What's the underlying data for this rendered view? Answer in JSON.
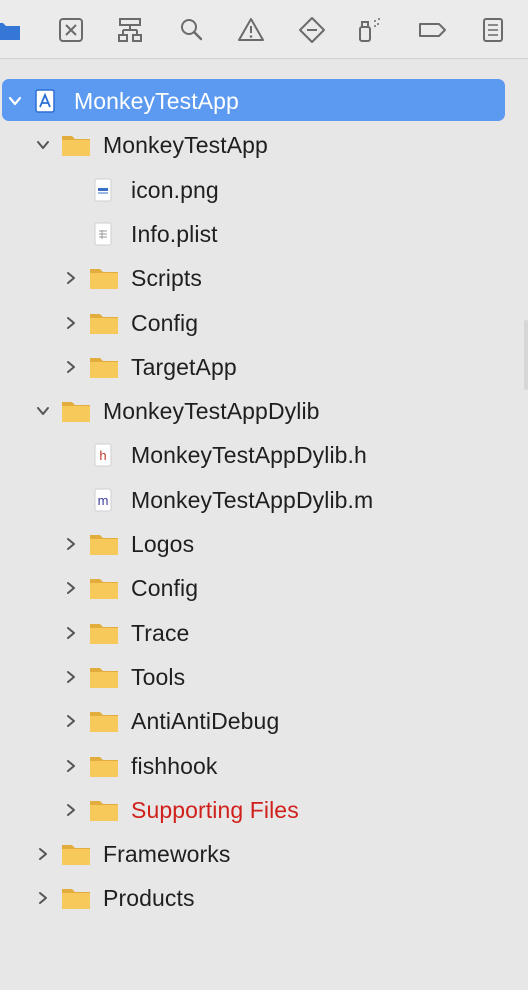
{
  "toolbar": {
    "icons": [
      "folder-icon",
      "source-control-icon",
      "hierarchy-icon",
      "search-icon",
      "warning-icon",
      "test-diamond-icon",
      "debug-spray-icon",
      "breakpoint-icon",
      "report-icon"
    ]
  },
  "tree": [
    {
      "label": "MonkeyTestApp",
      "kind": "project",
      "depth": 0,
      "disclosure": "open",
      "selected": true
    },
    {
      "label": "MonkeyTestApp",
      "kind": "folder",
      "depth": 1,
      "disclosure": "open"
    },
    {
      "label": "icon.png",
      "kind": "png",
      "depth": 2,
      "disclosure": "none"
    },
    {
      "label": "Info.plist",
      "kind": "plist",
      "depth": 2,
      "disclosure": "none"
    },
    {
      "label": "Scripts",
      "kind": "folder",
      "depth": 2,
      "disclosure": "closed"
    },
    {
      "label": "Config",
      "kind": "folder",
      "depth": 2,
      "disclosure": "closed"
    },
    {
      "label": "TargetApp",
      "kind": "folder",
      "depth": 2,
      "disclosure": "closed"
    },
    {
      "label": "MonkeyTestAppDylib",
      "kind": "folder",
      "depth": 1,
      "disclosure": "open"
    },
    {
      "label": "MonkeyTestAppDylib.h",
      "kind": "h",
      "depth": 2,
      "disclosure": "none"
    },
    {
      "label": "MonkeyTestAppDylib.m",
      "kind": "m",
      "depth": 2,
      "disclosure": "none"
    },
    {
      "label": "Logos",
      "kind": "folder",
      "depth": 2,
      "disclosure": "closed"
    },
    {
      "label": "Config",
      "kind": "folder",
      "depth": 2,
      "disclosure": "closed"
    },
    {
      "label": "Trace",
      "kind": "folder",
      "depth": 2,
      "disclosure": "closed"
    },
    {
      "label": "Tools",
      "kind": "folder",
      "depth": 2,
      "disclosure": "closed"
    },
    {
      "label": "AntiAntiDebug",
      "kind": "folder",
      "depth": 2,
      "disclosure": "closed"
    },
    {
      "label": "fishhook",
      "kind": "folder",
      "depth": 2,
      "disclosure": "closed"
    },
    {
      "label": "Supporting Files",
      "kind": "folder",
      "depth": 2,
      "disclosure": "closed",
      "missing": true
    },
    {
      "label": "Frameworks",
      "kind": "folder",
      "depth": 1,
      "disclosure": "closed"
    },
    {
      "label": "Products",
      "kind": "folder",
      "depth": 1,
      "disclosure": "closed"
    }
  ],
  "colors": {
    "selection": "#5b9af0",
    "missing_text": "#d0201b",
    "folder": "#f6c95a",
    "icon_gray": "#6b6b6b"
  }
}
